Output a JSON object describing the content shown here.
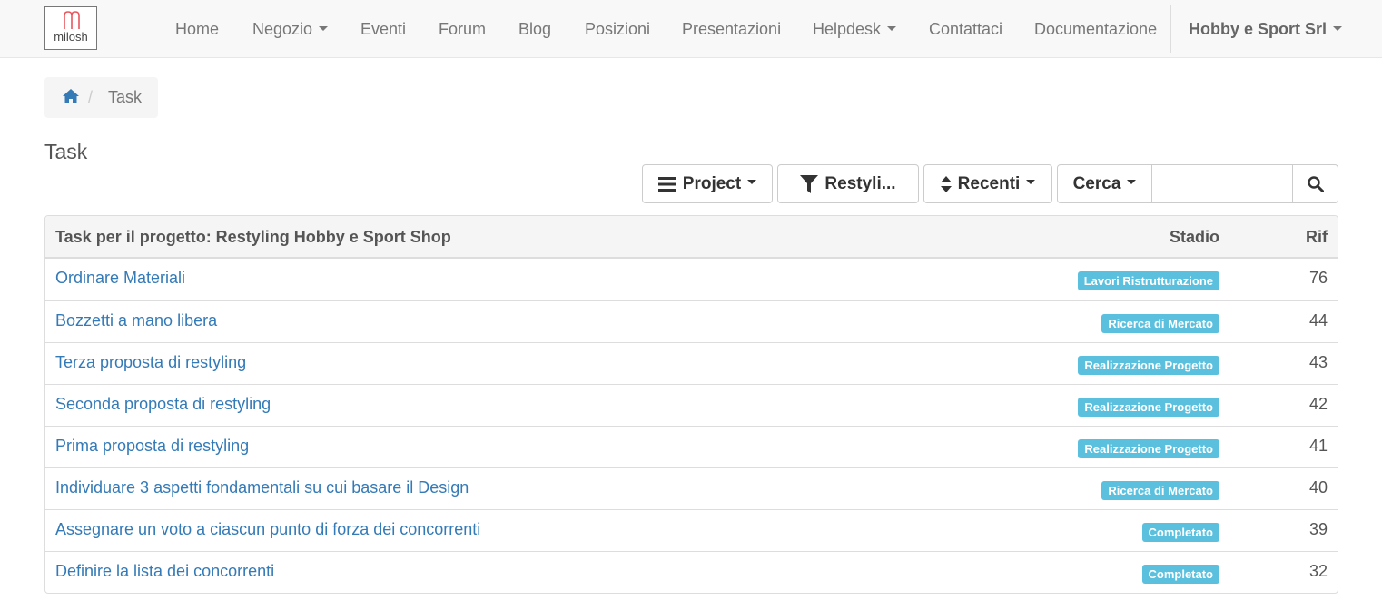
{
  "brand": {
    "logo_text": "milosh",
    "accent": "#e8565d"
  },
  "nav": {
    "items": [
      {
        "label": "Home",
        "dropdown": false
      },
      {
        "label": "Negozio",
        "dropdown": true
      },
      {
        "label": "Eventi",
        "dropdown": false
      },
      {
        "label": "Forum",
        "dropdown": false
      },
      {
        "label": "Blog",
        "dropdown": false
      },
      {
        "label": "Posizioni",
        "dropdown": false
      },
      {
        "label": "Presentazioni",
        "dropdown": false
      },
      {
        "label": "Helpdesk",
        "dropdown": true
      },
      {
        "label": "Contattaci",
        "dropdown": false
      },
      {
        "label": "Documentazione",
        "dropdown": false
      }
    ],
    "company": "Hobby e Sport Srl"
  },
  "breadcrumb": {
    "home_icon": "home-icon",
    "current": "Task"
  },
  "page": {
    "title": "Task"
  },
  "toolbar": {
    "project_label": "Project",
    "filter_label": "Restyli...",
    "sort_label": "Recenti",
    "search_label": "Cerca",
    "search_value": "",
    "search_icon": "search-icon"
  },
  "table": {
    "header_title": "Task per il progetto: Restyling Hobby e Sport Shop",
    "header_stage": "Stadio",
    "header_ref": "Rif",
    "rows": [
      {
        "name": "Ordinare Materiali",
        "stage": "Lavori Ristrutturazione",
        "ref": "76"
      },
      {
        "name": "Bozzetti a mano libera",
        "stage": "Ricerca di Mercato",
        "ref": "44"
      },
      {
        "name": "Terza proposta di restyling",
        "stage": "Realizzazione Progetto",
        "ref": "43"
      },
      {
        "name": "Seconda proposta di restyling",
        "stage": "Realizzazione Progetto",
        "ref": "42"
      },
      {
        "name": "Prima proposta di restyling",
        "stage": "Realizzazione Progetto",
        "ref": "41"
      },
      {
        "name": "Individuare 3 aspetti fondamentali su cui basare il Design",
        "stage": "Ricerca di Mercato",
        "ref": "40"
      },
      {
        "name": "Assegnare un voto a ciascun punto di forza dei concorrenti",
        "stage": "Completato",
        "ref": "39"
      },
      {
        "name": "Definire la lista dei concorrenti",
        "stage": "Completato",
        "ref": "32"
      }
    ]
  },
  "colors": {
    "link": "#337ab7",
    "badge": "#5bc0de"
  }
}
